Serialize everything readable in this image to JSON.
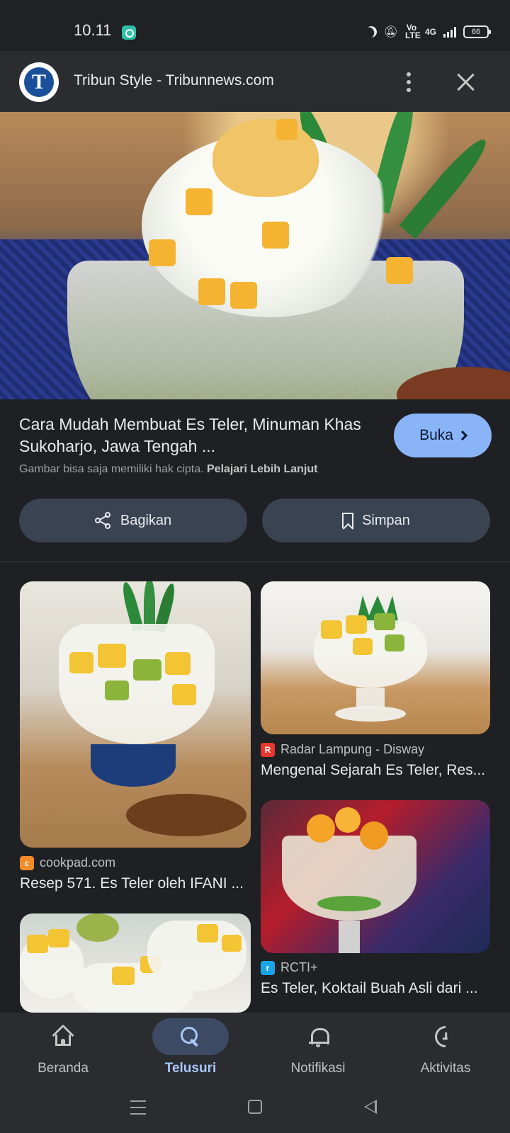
{
  "status_bar": {
    "time": "10.11",
    "network_label": "Vo LTE",
    "network_type": "4G",
    "battery": "66"
  },
  "source": {
    "name": "Tribun Style - Tribunnews.com",
    "logo_letter": "T"
  },
  "result": {
    "title": "Cara Mudah Membuat Es Teler, Minuman Khas Sukoharjo, Jawa Tengah ...",
    "open_button": "Buka",
    "copyright_text": "Gambar bisa saja memiliki hak cipta.",
    "learn_more": "Pelajari Lebih Lanjut",
    "share_button": "Bagikan",
    "save_button": "Simpan"
  },
  "related": [
    {
      "source": "cookpad.com",
      "caption": "Resep 571. Es Teler oleh IFANI ...",
      "favicon_color": "#f28c28",
      "favicon_letter": "c"
    },
    {
      "source": "Radar Lampung - Disway",
      "caption": "Mengenal Sejarah Es Teler, Res...",
      "favicon_color": "#e7372f",
      "favicon_letter": "R"
    },
    {
      "source": "RCTI+",
      "caption": "Es Teler, Koktail Buah Asli dari ...",
      "favicon_color": "#1aa6e6",
      "favicon_letter": "r"
    }
  ],
  "bottom_nav": {
    "items": [
      {
        "label": "Beranda",
        "icon": "home-icon"
      },
      {
        "label": "Telusuri",
        "icon": "search-icon",
        "active": true
      },
      {
        "label": "Notifikasi",
        "icon": "bell-icon"
      },
      {
        "label": "Aktivitas",
        "icon": "activity-icon"
      }
    ]
  },
  "colors": {
    "background": "#1f2023",
    "accent": "#8ab4f8",
    "active_nav": "#a8c7fa"
  }
}
